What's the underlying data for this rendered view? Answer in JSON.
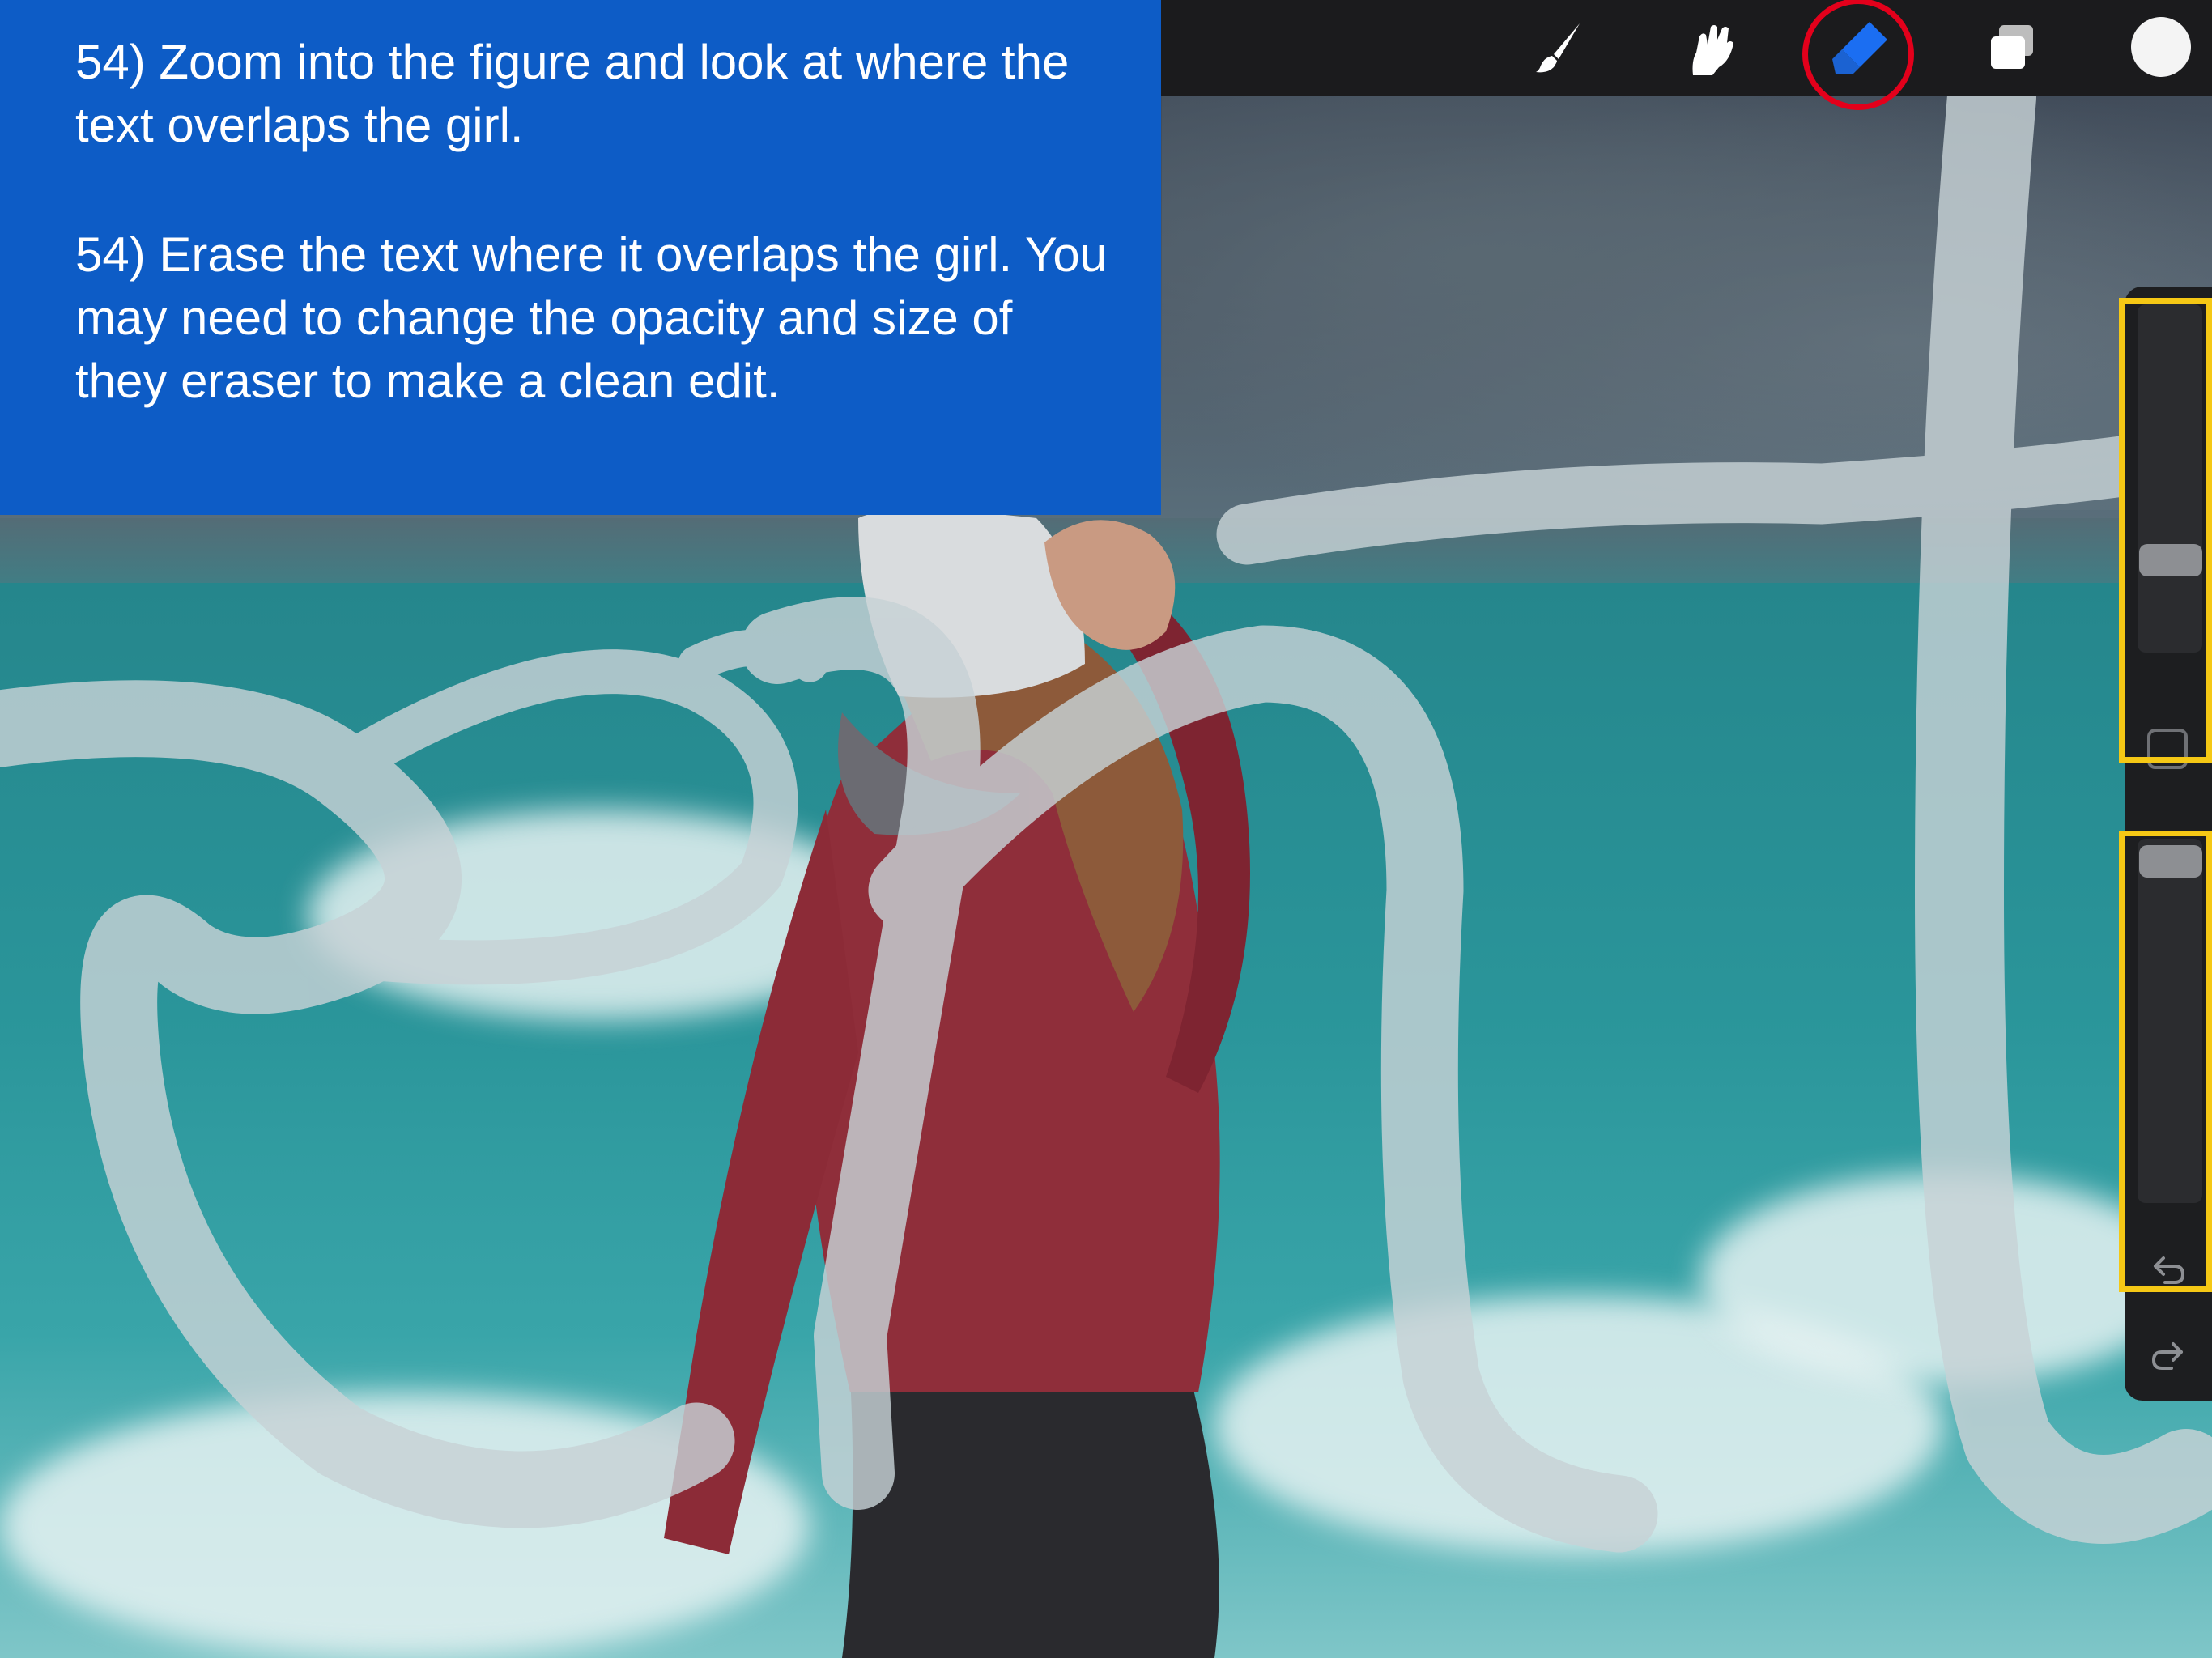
{
  "instructions": {
    "step_a": "54) Zoom into the figure and look at where the text overlaps the girl.",
    "step_b": "54) Erase the text where it overlaps the girl. You may need to change the opacity and size of they eraser to make a clean edit."
  },
  "toolbar": {
    "tools": [
      {
        "id": "brush",
        "icon": "brush-icon"
      },
      {
        "id": "smudge",
        "icon": "smudge-icon"
      },
      {
        "id": "eraser",
        "icon": "eraser-icon",
        "active": true
      },
      {
        "id": "layers",
        "icon": "layers-icon"
      },
      {
        "id": "color",
        "icon": "color-swatch"
      }
    ],
    "active_color": "#f4f4f4",
    "active_tool_accent": "#1b6ef2"
  },
  "sidebar": {
    "brush_size_level": 0.25,
    "opacity_level": 1.0,
    "icons": [
      "modify-button",
      "undo-icon",
      "redo-icon"
    ]
  },
  "annotations": {
    "circle_color": "#e3001b",
    "box_color": "#f5c815"
  }
}
